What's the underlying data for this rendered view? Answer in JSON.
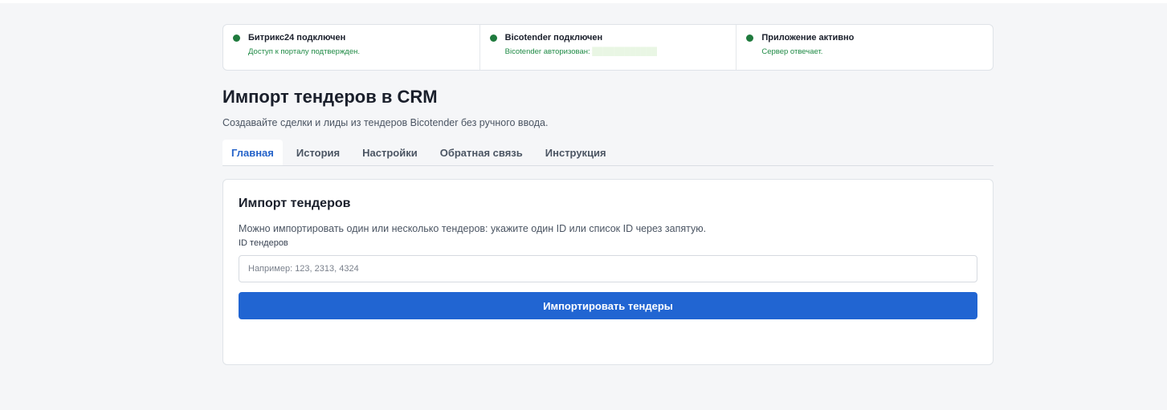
{
  "status": [
    {
      "title": "Битрикс24 подключен",
      "subtitle": "Доступ к порталу подтвержден.",
      "extra": ""
    },
    {
      "title": "Bicotender подключен",
      "subtitle": "Bicotender авторизован:",
      "extra": "████████████"
    },
    {
      "title": "Приложение активно",
      "subtitle": "Сервер отвечает.",
      "extra": ""
    }
  ],
  "colors": {
    "status_ok": "#1f7a3d",
    "accent": "#2165d2",
    "background": "#f5f6f8"
  },
  "header": {
    "title": "Импорт тендеров в CRM",
    "subtitle": "Создавайте сделки и лиды из тендеров Bicotender без ручного ввода."
  },
  "tabs": [
    {
      "label": "Главная",
      "active": true
    },
    {
      "label": "История",
      "active": false
    },
    {
      "label": "Настройки",
      "active": false
    },
    {
      "label": "Обратная связь",
      "active": false
    },
    {
      "label": "Инструкция",
      "active": false
    }
  ],
  "import_card": {
    "title": "Импорт тендеров",
    "description": "Можно импортировать один или несколько тендеров: укажите один ID или список ID через запятую.",
    "field_label": "ID тендеров",
    "field_value": "",
    "field_placeholder": "Например: 123, 2313, 4324",
    "button_label": "Импортировать тендеры"
  }
}
